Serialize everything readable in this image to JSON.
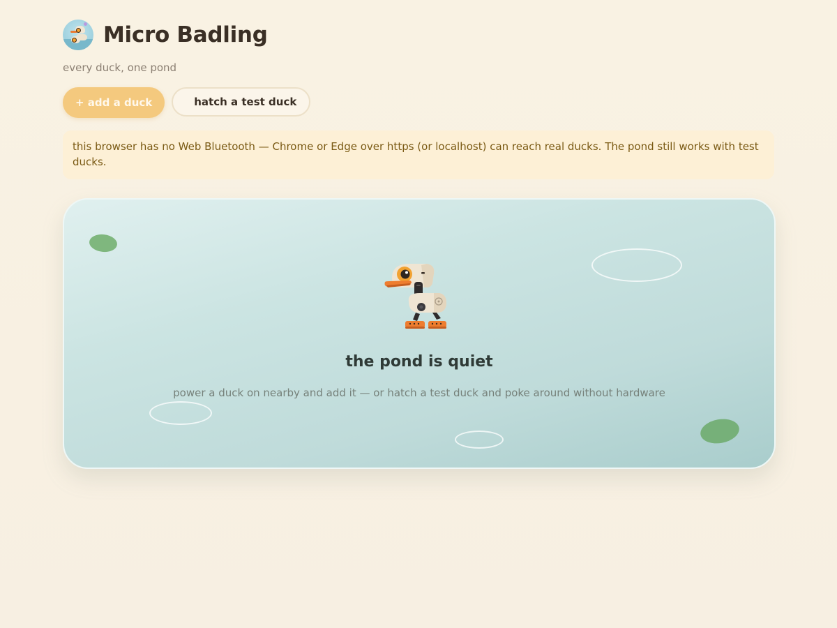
{
  "app": {
    "title": "Micro Badling",
    "tagline": "every duck, one pond"
  },
  "actions": {
    "add_label": "+ add a duck",
    "hatch_label": "hatch a test duck"
  },
  "notice": {
    "text": "this browser has no Web Bluetooth — Chrome or Edge over https (or localhost) can reach real ducks. The pond still works with test ducks."
  },
  "pond": {
    "empty_title": "the pond is quiet",
    "empty_subtitle": "power a duck on nearby and add it — or hatch a test duck and poke around without hardware"
  },
  "colors": {
    "background": "#f8f0e2",
    "primary_button": "#f4c97e",
    "notice_bg": "#fdf0d6",
    "notice_text": "#7a5a14",
    "pond_water": "#c3dddc",
    "lily_pad": "#7fb77e"
  },
  "icons": {
    "logo": "duck-logo-icon",
    "illustration": "duck-robot-icon"
  }
}
